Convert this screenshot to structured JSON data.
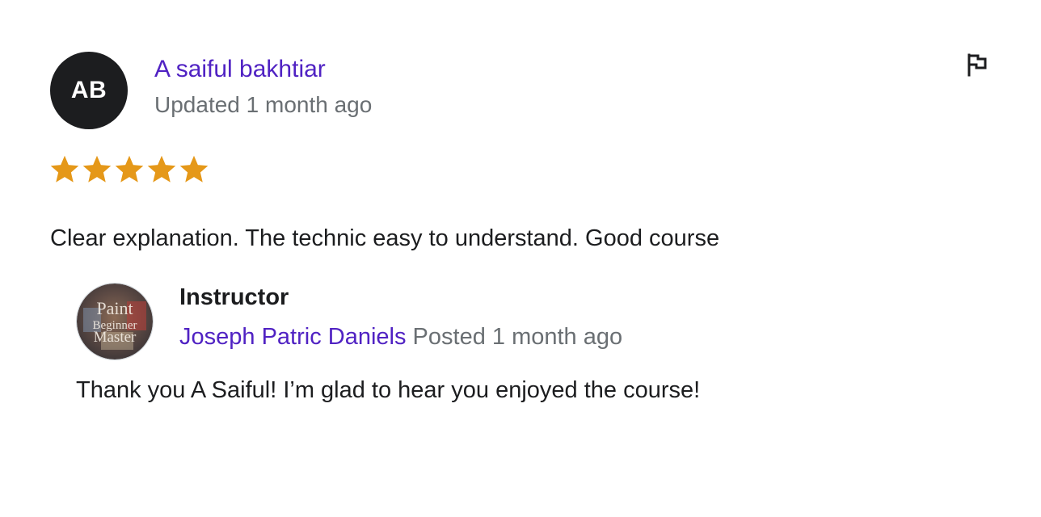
{
  "review": {
    "reviewer": {
      "initials": "AB",
      "name": "A saiful bakhtiar",
      "updated": "Updated 1 month ago"
    },
    "rating": 5,
    "rating_max": 5,
    "star_color": "#e59819",
    "text": "Clear explanation. The technic easy to understand. Good course",
    "flag_icon": "flag-icon"
  },
  "reply": {
    "label": "Instructor",
    "name": "Joseph Patric Daniels",
    "posted": "Posted 1 month ago",
    "text": "Thank you A Saiful! I’m glad to hear you enjoyed the course!",
    "avatar_lines": [
      "Paint",
      "Beginner",
      "Master"
    ]
  },
  "colors": {
    "link": "#5022c3",
    "muted": "#6a6f73",
    "text": "#1c1d1f"
  }
}
